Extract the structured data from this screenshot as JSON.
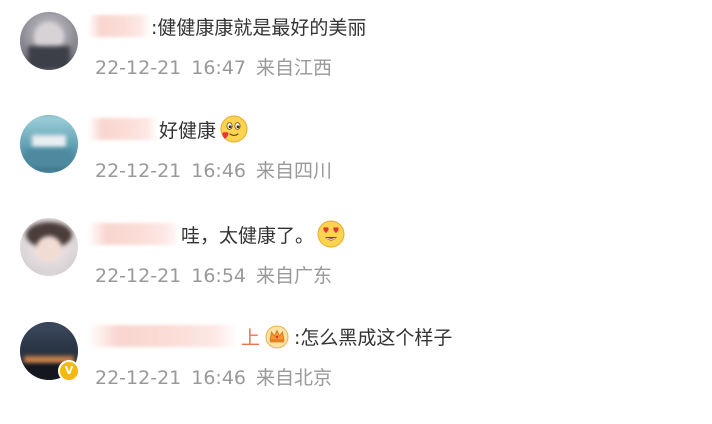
{
  "comments": [
    {
      "avatar_icon": "user-avatar-photo",
      "text": ":健健康康就是最好的美丽",
      "date": "22-12-21",
      "time": "16:47",
      "location": "来自江西",
      "emoji": null
    },
    {
      "avatar_icon": "user-avatar-photo",
      "text": "好健康",
      "date": "22-12-21",
      "time": "16:46",
      "location": "来自四川",
      "emoji": "hugging-heart-emoji"
    },
    {
      "avatar_icon": "user-avatar-photo",
      "text": "哇，太健康了。",
      "date": "22-12-21",
      "time": "16:54",
      "location": "来自广东",
      "emoji": "heart-eyes-emoji"
    },
    {
      "avatar_icon": "user-avatar-photo",
      "username_suffix": "上",
      "text": ":怎么黑成这个样子",
      "date": "22-12-21",
      "time": "16:46",
      "location": "来自北京",
      "emoji": "crown-badge-icon",
      "verified_badge": "V"
    }
  ],
  "colors": {
    "text": "#333333",
    "meta": "#999999",
    "verified": "#f5b80f",
    "accent": "#eb7350"
  }
}
